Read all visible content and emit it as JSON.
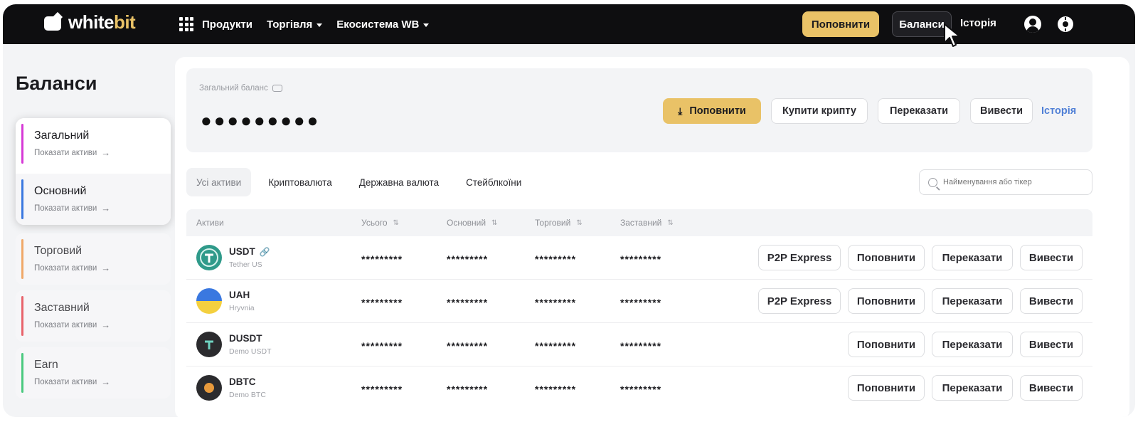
{
  "brand": {
    "part1": "white",
    "part2": "bit"
  },
  "nav": {
    "products": "Продукти",
    "trading": "Торгівля",
    "ecosystem": "Екосистема WB"
  },
  "header": {
    "topup": "Поповнити",
    "balances": "Баланси",
    "history": "Історія"
  },
  "sidebar": {
    "title": "Баланси",
    "items": [
      {
        "label": "Загальний",
        "sub": "Показати активи",
        "color": "#d63ad6"
      },
      {
        "label": "Основний",
        "sub": "Показати активи",
        "color": "#3a78e0"
      },
      {
        "label": "Торговий",
        "sub": "Показати активи",
        "color": "#f0a868"
      },
      {
        "label": "Заставний",
        "sub": "Показати активи",
        "color": "#e8636b"
      },
      {
        "label": "Earn",
        "sub": "Показати активи",
        "color": "#4ac97f"
      }
    ]
  },
  "balance": {
    "label": "Загальний баланс",
    "value": "●●●●●●●●●",
    "actions": {
      "topup": "Поповнити",
      "buy": "Купити крипту",
      "transfer": "Переказати",
      "withdraw": "Вивести",
      "history": "Історія"
    }
  },
  "tabs": [
    "Усі активи",
    "Криптовалюта",
    "Державна валюта",
    "Стейблкоїни"
  ],
  "search": {
    "placeholder": "Найменування або тікер"
  },
  "table": {
    "headers": [
      "Активи",
      "Усього",
      "Основний",
      "Торговий",
      "Заставний"
    ],
    "rows": [
      {
        "ticker": "USDT",
        "name": "Tether US",
        "mask": "*********",
        "p2p": "P2P Express",
        "topup": "Поповнити",
        "transfer": "Переказати",
        "withdraw": "Вивести"
      },
      {
        "ticker": "UAH",
        "name": "Hryvnia",
        "mask": "*********",
        "p2p": "P2P Express",
        "topup": "Поповнити",
        "transfer": "Переказати",
        "withdraw": "Вивести"
      },
      {
        "ticker": "DUSDT",
        "name": "Demo USDT",
        "mask": "*********",
        "topup": "Поповнити",
        "transfer": "Переказати",
        "withdraw": "Вивести"
      },
      {
        "ticker": "DBTC",
        "name": "Demo BTC",
        "mask": "*********",
        "topup": "Поповнити",
        "transfer": "Переказати",
        "withdraw": "Вивести"
      }
    ]
  },
  "colors": {
    "accent": "#e9c267",
    "topbar": "#0e0e10",
    "link": "#4f7fd6"
  },
  "icons": [
    "grid-icon",
    "user-icon",
    "settings-icon",
    "eye-icon",
    "search-icon",
    "sort-icon",
    "link-icon",
    "arrow-right-icon",
    "download-icon",
    "cursor-icon"
  ]
}
